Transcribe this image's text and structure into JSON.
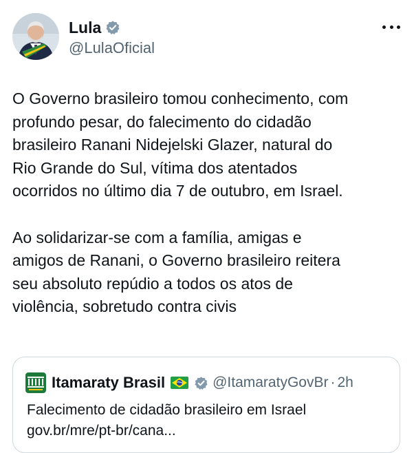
{
  "post": {
    "author": {
      "display_name": "Lula",
      "handle": "@LulaOficial",
      "verified_icon": "gray-verified-badge-icon",
      "avatar_icon": "portrait-with-sash-avatar"
    },
    "more_icon": "more-horizontal-icon",
    "paragraphs": [
      "O Governo brasileiro tomou conhecimento, com\nprofundo pesar, do falecimento do cidadão\nbrasileiro Ranani Nidejelski Glazer, natural do\nRio Grande do Sul, vítima dos atentados\nocorridos no último dia 7 de outubro, em Israel.",
      "Ao solidarizar-se com a família, amigas e\namigos de Ranani, o Governo brasileiro reitera\nseu absoluto repúdio a todos os atos de\nviolência, sobretudo contra civis"
    ]
  },
  "quote": {
    "logo_icon": "itamaraty-logo-icon",
    "name": "Itamaraty Brasil",
    "flag_icon": "brazil-flag-icon",
    "badge_icon": "gray-verified-badge-icon",
    "handle": "@ItamaratyGovBr",
    "separator": "·",
    "time": "2h",
    "text": "Falecimento de cidadão brasileiro em Israel\ngov.br/mre/pt-br/cana..."
  },
  "colors": {
    "text_primary": "#0f1419",
    "text_secondary": "#536471",
    "border": "#cfd9de",
    "badge_gray": "#829aab"
  }
}
